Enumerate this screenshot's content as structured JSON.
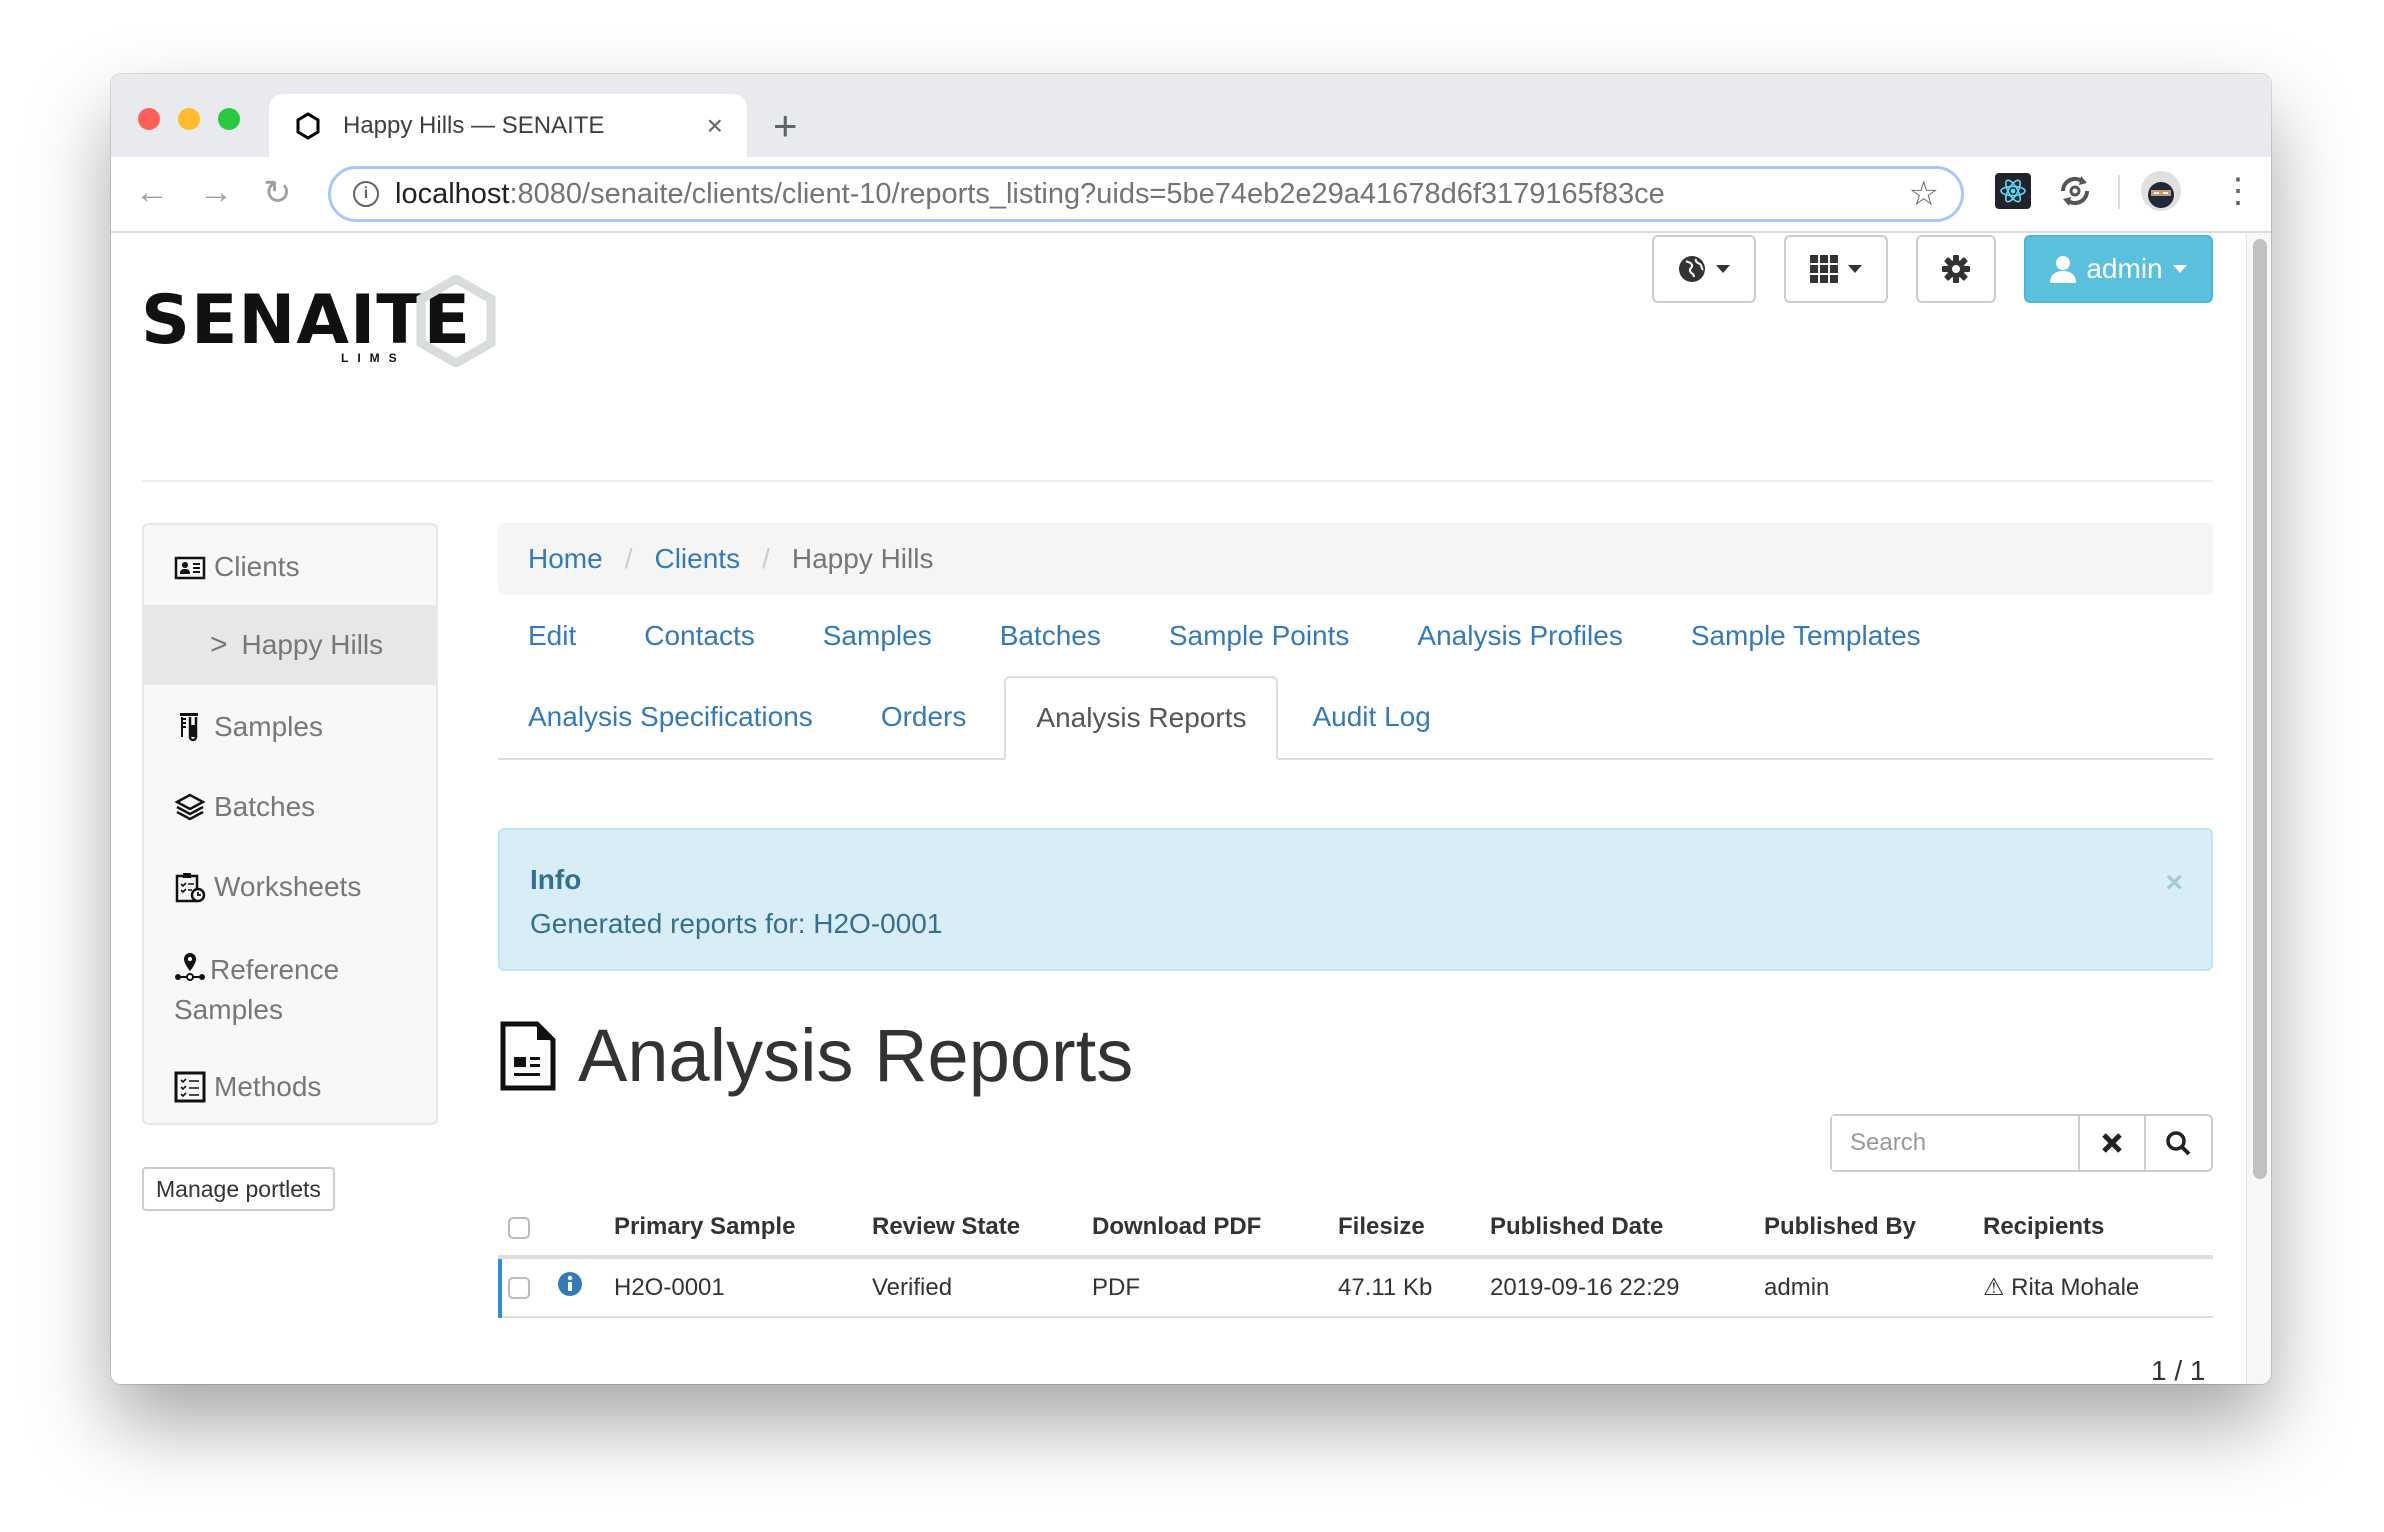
{
  "browser": {
    "tab_title": "Happy Hills — SENAITE",
    "tab_close": "×",
    "new_tab": "+",
    "url_host": "localhost",
    "url_rest": ":8080/senaite/clients/client-10/reports_listing?uids=5be74eb2e29a41678d6f3179165f83ce",
    "nav": {
      "back": "←",
      "forward": "→",
      "reload": "↻"
    },
    "star": "☆",
    "menu": "⋮"
  },
  "header": {
    "logo_text": "SENAITE",
    "logo_sub": "LIMS",
    "user_label": "admin"
  },
  "sidebar": {
    "items": [
      {
        "label": "Clients",
        "icon": "client-card-icon"
      },
      {
        "label": "Happy Hills",
        "icon": "chevron-right-icon",
        "active": true
      },
      {
        "label": "Samples",
        "icon": "test-tube-icon"
      },
      {
        "label": "Batches",
        "icon": "layers-icon"
      },
      {
        "label": "Worksheets",
        "icon": "clipboard-clock-icon"
      },
      {
        "label": "Reference Samples",
        "icon": "reference-pin-icon"
      },
      {
        "label": "Methods",
        "icon": "checklist-icon"
      }
    ],
    "manage_portlets": "Manage portlets"
  },
  "breadcrumb": {
    "items": [
      {
        "label": "Home",
        "link": true
      },
      {
        "label": "Clients",
        "link": true
      },
      {
        "label": "Happy Hills",
        "link": false
      }
    ],
    "separator": "/"
  },
  "tabs": {
    "row1": [
      "Edit",
      "Contacts",
      "Samples",
      "Batches",
      "Sample Points",
      "Analysis Profiles",
      "Sample Templates"
    ],
    "row2": [
      "Analysis Specifications",
      "Orders",
      "Analysis Reports",
      "Audit Log"
    ],
    "active": "Analysis Reports"
  },
  "alert": {
    "title": "Info",
    "message": "Generated reports for: H2O-0001",
    "close": "×"
  },
  "main": {
    "title": "Analysis Reports"
  },
  "search": {
    "placeholder": "Search"
  },
  "table": {
    "columns": [
      "",
      "",
      "Primary Sample",
      "Review State",
      "Download PDF",
      "Filesize",
      "Published Date",
      "Published By",
      "Recipients"
    ],
    "rows": [
      {
        "primary_sample": "H2O-0001",
        "review_state": "Verified",
        "download_pdf": "PDF",
        "filesize": "47.11 Kb",
        "published_date": "2019-09-16 22:29",
        "published_by": "admin",
        "recipients": "⚠ Rita Mohale"
      }
    ]
  },
  "pager": "1 / 1",
  "colors": {
    "link": "#337ab7",
    "admin_button": "#5bc0de",
    "info_bg": "#d9edf7",
    "info_text": "#31708f",
    "recipient_warning": "#a94442",
    "row_marker": "#2d8fd5"
  }
}
